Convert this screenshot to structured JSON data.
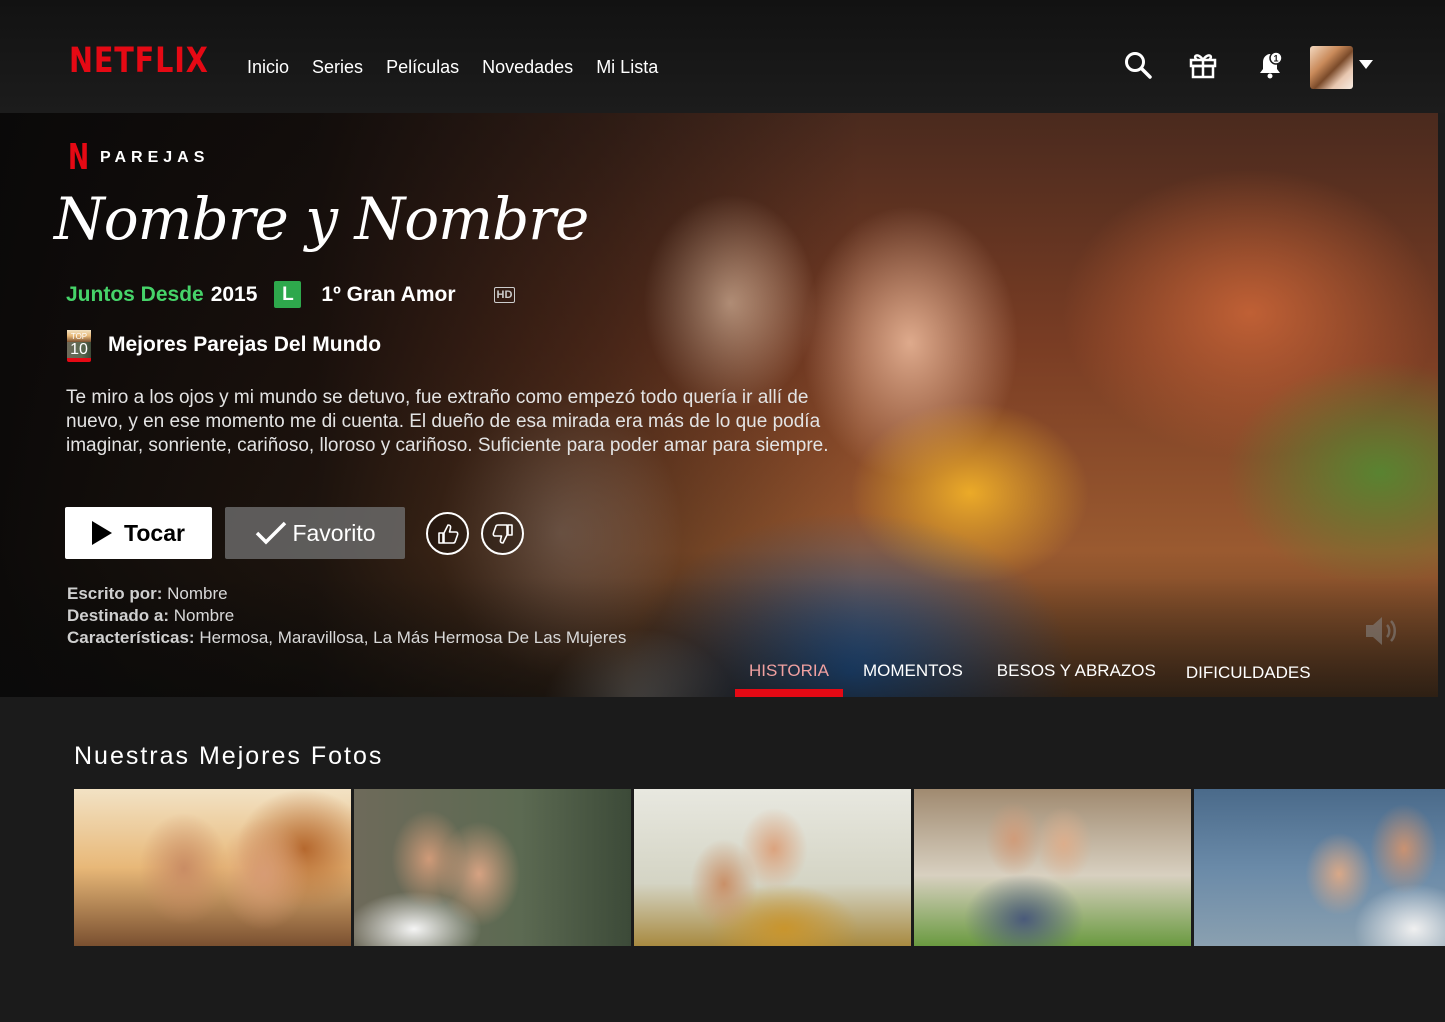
{
  "header": {
    "logo": "NETFLIX",
    "nav": [
      "Inicio",
      "Series",
      "Películas",
      "Novedades",
      "Mi Lista"
    ],
    "notification_count": "1"
  },
  "hero": {
    "brand_letter": "N",
    "brand_label": "PAREJAS",
    "title": "Nombre y Nombre",
    "meta": {
      "together_label": "Juntos Desde",
      "year": "2015",
      "rating": "L",
      "subtitle": "1º Gran Amor",
      "quality": "HD"
    },
    "top10": {
      "top": "TOP",
      "num": "10",
      "text": "Mejores Parejas Del Mundo"
    },
    "description": "Te miro a los ojos y mi mundo se detuvo, fue extraño como empezó todo quería ir allí de nuevo, y en ese momento me di cuenta. El dueño de esa mirada era más de lo que podía imaginar, sonriente, cariñoso, lloroso y cariñoso. Suficiente para poder amar para siempre.",
    "buttons": {
      "play": "Tocar",
      "favorite": "Favorito"
    },
    "credits": {
      "written_label": "Escrito por:",
      "written_value": "Nombre",
      "dest_label": "Destinado a:",
      "dest_value": "Nombre",
      "traits_label": "Características:",
      "traits_value": "Hermosa, Maravillosa, La Más Hermosa De Las Mujeres"
    },
    "tabs": [
      "HISTORIA",
      "MOMENTOS",
      "BESOS Y ABRAZOS",
      "DIFICULDADES"
    ]
  },
  "row": {
    "title": "Nuestras Mejores Fotos"
  },
  "colors": {
    "brand_red": "#e50914",
    "green": "#46d369",
    "background": "#1b1b1b"
  }
}
